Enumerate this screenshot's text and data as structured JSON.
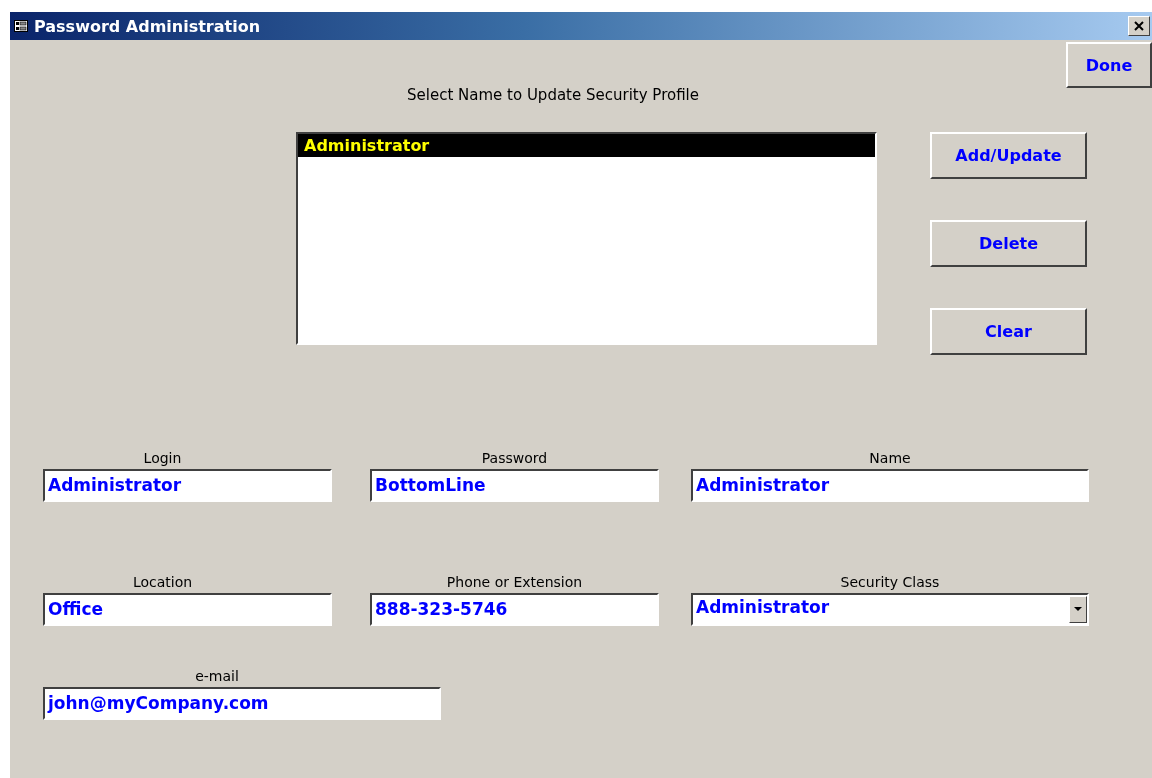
{
  "window": {
    "title": "Password Administration"
  },
  "done_button": "Done",
  "heading": "Select Name to Update Security Profile",
  "name_list": [
    {
      "label": "Administrator",
      "selected": true
    }
  ],
  "buttons": [
    "Add/Update",
    "Delete",
    "Clear"
  ],
  "field_rows": [
    [
      {
        "label": "Login",
        "value": "Administrator",
        "kind": "text"
      },
      {
        "label": "Password",
        "value": "BottomLine",
        "kind": "text"
      },
      {
        "label": "Name",
        "value": "Administrator",
        "kind": "text"
      }
    ],
    [
      {
        "label": "Location",
        "value": "Office",
        "kind": "text"
      },
      {
        "label": "Phone or Extension",
        "value": "888-323-5746",
        "kind": "text"
      },
      {
        "label": "Security Class",
        "value": "Administrator",
        "kind": "combo"
      }
    ],
    [
      {
        "label": "e-mail",
        "value": "john@myCompany.com",
        "kind": "text"
      }
    ]
  ]
}
